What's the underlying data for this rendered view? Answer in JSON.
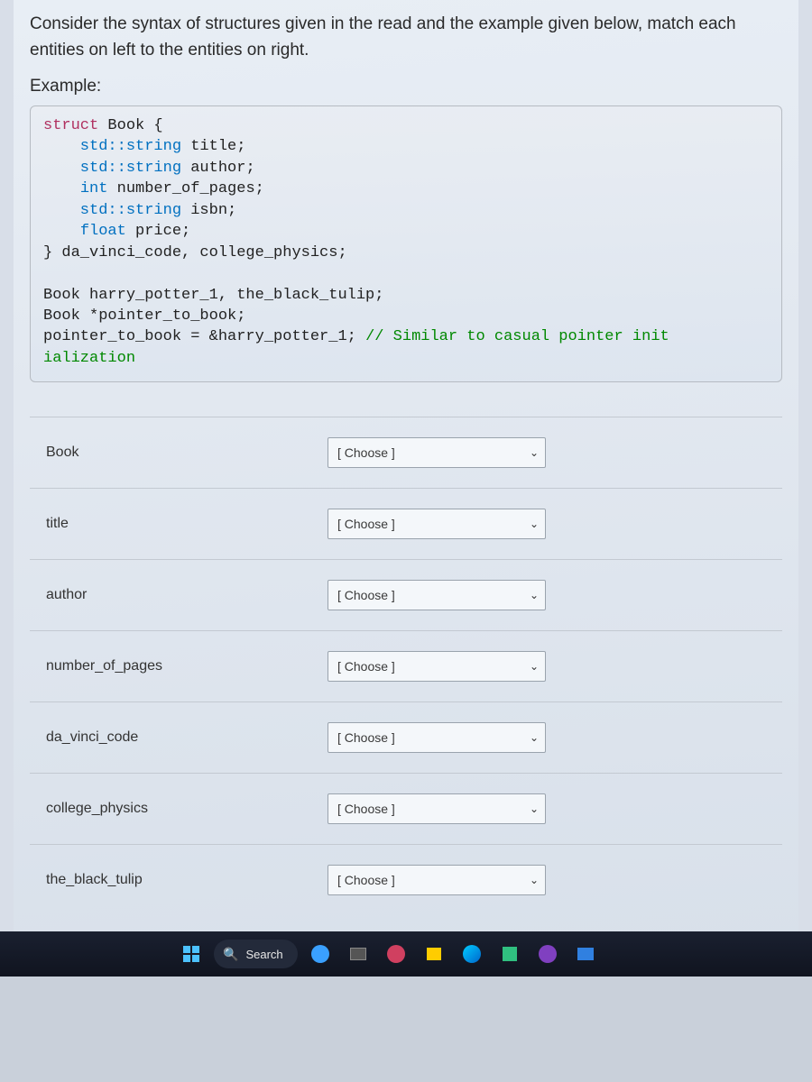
{
  "instructions": "Consider the syntax of structures given in the read and the example given below, match each entities on left to the entities on right.",
  "exampleLabel": "Example:",
  "code": {
    "l1a": "struct",
    "l1b": " Book {",
    "l2a": "    std::string",
    "l2b": " title;",
    "l3a": "    std::string",
    "l3b": " author;",
    "l4a": "    ",
    "l4b": "int",
    "l4c": " number_of_pages;",
    "l5a": "    std::string",
    "l5b": " isbn;",
    "l6a": "    ",
    "l6b": "float",
    "l6c": " price;",
    "l7": "} da_vinci_code, college_physics;",
    "blank": "",
    "l8": "Book harry_potter_1, the_black_tulip;",
    "l9": "Book *pointer_to_book;",
    "l10a": "pointer_to_book = &harry_potter_1; ",
    "l10b": "// Similar to casual pointer init",
    "l11": "ialization"
  },
  "choosePlaceholder": "[ Choose ]",
  "rows": [
    {
      "label": "Book"
    },
    {
      "label": "title"
    },
    {
      "label": "author"
    },
    {
      "label": "number_of_pages"
    },
    {
      "label": "da_vinci_code"
    },
    {
      "label": "college_physics"
    },
    {
      "label": "the_black_tulip"
    }
  ],
  "taskbar": {
    "search": "Search"
  }
}
